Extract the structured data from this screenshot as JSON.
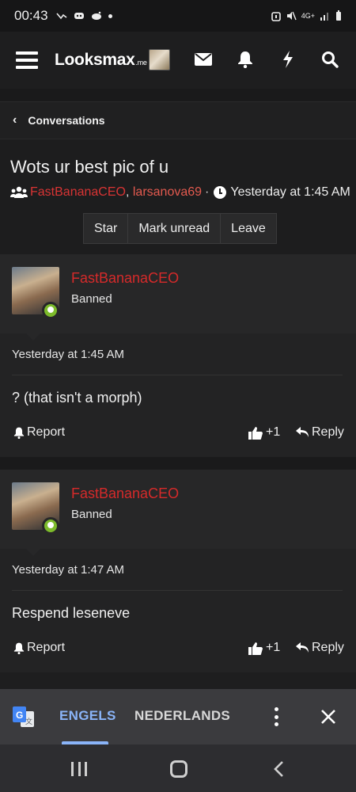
{
  "status_bar": {
    "time": "00:43",
    "network": "4G+"
  },
  "header": {
    "logo_main": "Looksmax",
    "logo_suffix": ".me"
  },
  "breadcrumb": {
    "label": "Conversations"
  },
  "conversation": {
    "title": "Wots ur best pic of u",
    "participant_1": "FastBananaCEO",
    "comma": ",",
    "participant_2": "larsanova69",
    "separator": "·",
    "timestamp": "Yesterday at 1:45 AM",
    "buttons": [
      "Star",
      "Mark unread",
      "Leave"
    ]
  },
  "messages": [
    {
      "username": "FastBananaCEO",
      "role": "Banned",
      "date": "Yesterday at 1:45 AM",
      "body": "? (that isn't a morph)",
      "report_label": "Report",
      "like_label": "+1",
      "reply_label": "Reply"
    },
    {
      "username": "FastBananaCEO",
      "role": "Banned",
      "date": "Yesterday at 1:47 AM",
      "body": "Respend leseneve",
      "report_label": "Report",
      "like_label": "+1",
      "reply_label": "Reply"
    }
  ],
  "translate_bar": {
    "source_language": "ENGELS",
    "target_language": "NEDERLANDS"
  },
  "colors": {
    "username_red": "#d62a2a",
    "link_red": "#e45a4f",
    "translate_accent": "#8ab4f8",
    "online_green": "#7dbb2b"
  }
}
